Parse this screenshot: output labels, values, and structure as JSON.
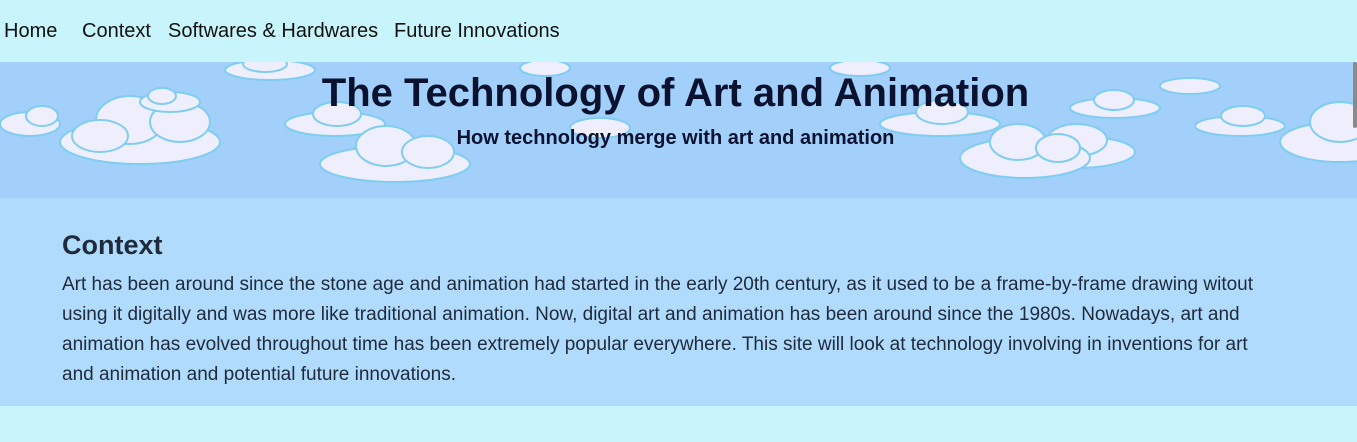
{
  "nav": {
    "items": [
      {
        "label": "Home"
      },
      {
        "label": "Context"
      },
      {
        "label": "Softwares & Hardwares"
      },
      {
        "label": "Future Innovations"
      }
    ]
  },
  "hero": {
    "title": "The Technology of Art and Animation",
    "subtitle": "How technology merge with art and animation"
  },
  "context": {
    "title": "Context",
    "body": "Art has been around since the stone age and animation had started in the early 20th century, as it used to be a frame-by-frame drawing witout using it digitally and was more like traditional animation. Now, digital art and animation has been around since the 1980s. Nowadays, art and animation has evolved throughout time has been extremely popular everywhere. This site will look at technology involving in inventions for art and animation and potential future innovations."
  },
  "colors": {
    "nav_bg": "#c8f4fc",
    "hero_bg": "#a3d0fb",
    "section_bg": "#b0dbfd",
    "cloud": "#eeeefc"
  }
}
